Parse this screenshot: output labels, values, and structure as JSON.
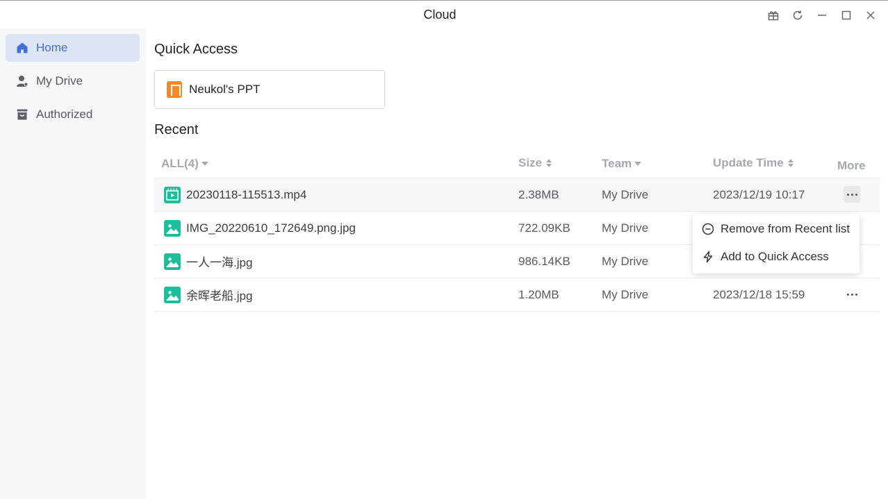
{
  "window": {
    "title": "Cloud",
    "controls": [
      "gift-icon",
      "refresh-icon",
      "minimize-icon",
      "maximize-icon",
      "close-icon"
    ]
  },
  "sidebar": {
    "items": [
      {
        "label": "Home",
        "icon": "home-icon",
        "active": true
      },
      {
        "label": "My Drive",
        "icon": "user-icon",
        "active": false
      },
      {
        "label": "Authorized",
        "icon": "archive-box-icon",
        "active": false
      }
    ]
  },
  "quick_access": {
    "title": "Quick Access",
    "items": [
      {
        "label": "Neukol's PPT",
        "icon": "ppt-file-icon"
      }
    ]
  },
  "recent": {
    "title": "Recent",
    "columns": {
      "all": "ALL(4)",
      "size": "Size",
      "team": "Team",
      "update_time": "Update Time",
      "more": "More"
    },
    "rows": [
      {
        "name": "20230118-115513.mp4",
        "size": "2.38MB",
        "team": "My Drive",
        "updated": "2023/12/19 10:17",
        "icon": "video-file-icon"
      },
      {
        "name": "IMG_20220610_172649.png.jpg",
        "size": "722.09KB",
        "team": "My Drive",
        "updated": "",
        "icon": "image-file-icon"
      },
      {
        "name": "一人一海.jpg",
        "size": "986.14KB",
        "team": "My Drive",
        "updated": "",
        "icon": "image-file-icon"
      },
      {
        "name": "余晖老船.jpg",
        "size": "1.20MB",
        "team": "My Drive",
        "updated": "2023/12/18 15:59",
        "icon": "image-file-icon"
      }
    ]
  },
  "context_menu": {
    "items": [
      {
        "label": "Remove from Recent list",
        "icon": "minus-circle-icon"
      },
      {
        "label": "Add to Quick Access",
        "icon": "lightning-icon"
      }
    ]
  },
  "colors": {
    "accent": "#3f6fd8",
    "active_nav_bg": "#dde5f4",
    "file_icon_green": "#1dbf9b",
    "ppt_orange": "#f5882c",
    "sidebar_bg": "#f6f7f9"
  }
}
